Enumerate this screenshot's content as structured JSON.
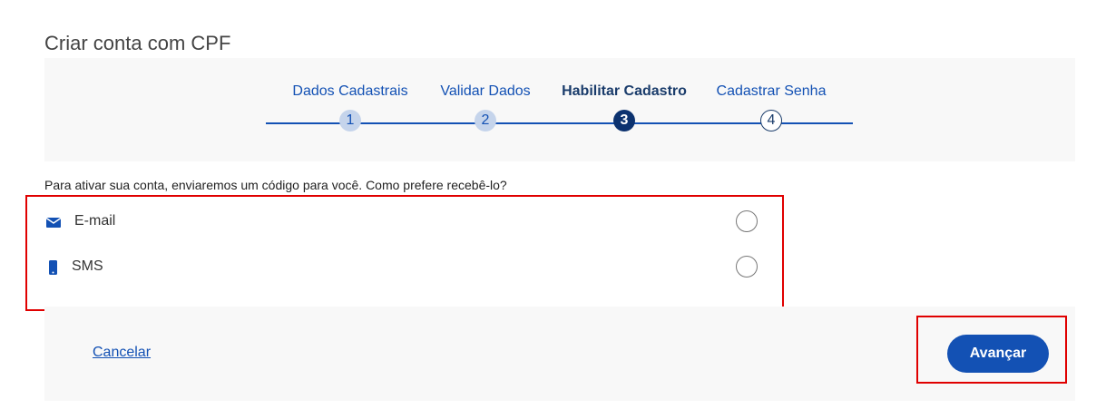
{
  "page": {
    "title": "Criar conta com CPF"
  },
  "stepper": {
    "steps": [
      {
        "label": "Dados Cadastrais",
        "number": "1",
        "state": "done"
      },
      {
        "label": "Validar Dados",
        "number": "2",
        "state": "done"
      },
      {
        "label": "Habilitar Cadastro",
        "number": "3",
        "state": "current"
      },
      {
        "label": "Cadastrar Senha",
        "number": "4",
        "state": "todo"
      }
    ]
  },
  "form": {
    "instruction": "Para ativar sua conta, enviaremos um código para você. Como prefere recebê-lo?",
    "options": [
      {
        "label": "E-mail",
        "icon": "envelope-icon",
        "selected": false
      },
      {
        "label": "SMS",
        "icon": "mobile-phone-icon",
        "selected": false
      }
    ]
  },
  "footer": {
    "cancel_label": "Cancelar",
    "advance_label": "Avançar"
  },
  "colors": {
    "primary": "#1351b4",
    "highlight_border": "#e00000",
    "panel_bg": "#f8f8f8"
  }
}
